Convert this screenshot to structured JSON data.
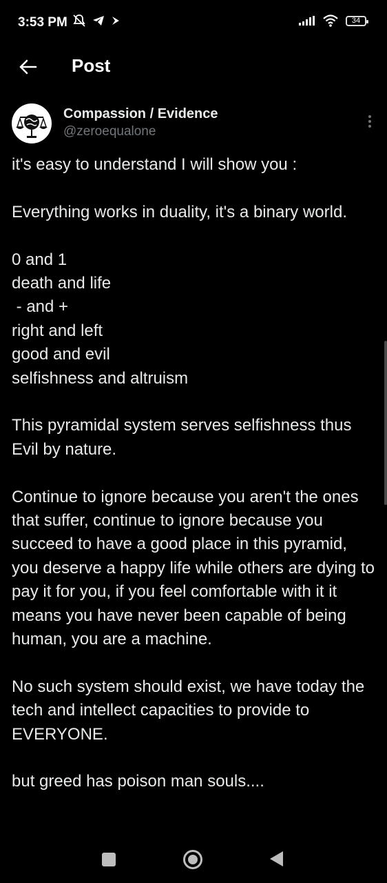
{
  "status_bar": {
    "time": "3:53 PM",
    "battery": "34",
    "icons_left": [
      "mute-icon",
      "telegram-icon",
      "bird-icon"
    ],
    "icons_right": [
      "signal-icon",
      "wifi-icon",
      "battery-icon"
    ]
  },
  "header": {
    "title": "Post",
    "back_icon": "arrow-left-icon"
  },
  "author": {
    "name": "Compassion / Evidence",
    "handle": "@zeroequalone",
    "avatar_icon": "globe-scales-icon",
    "more_icon": "more-vertical-icon"
  },
  "post": {
    "paragraphs": [
      "it's easy to understand I will show you :",
      "Everything works in duality, it's a binary world.",
      "0 and 1\ndeath and life\n - and +\nright and left\ngood and evil\nselfishness and altruism",
      "This pyramidal system serves selfishness thus Evil by nature.",
      "Continue to ignore because you aren't the ones that suffer, continue to ignore because you succeed to have a good place in this pyramid, you deserve a happy life while others are dying to pay it for you, if you feel comfortable with it it means you have never been capable of being human, you are a machine.",
      "No such system should exist, we have today the tech and intellect capacities to provide to EVERYONE.",
      "but greed has poison man souls...."
    ]
  },
  "nav_bar": {
    "items": [
      "recents-icon",
      "home-icon",
      "back-icon"
    ]
  }
}
